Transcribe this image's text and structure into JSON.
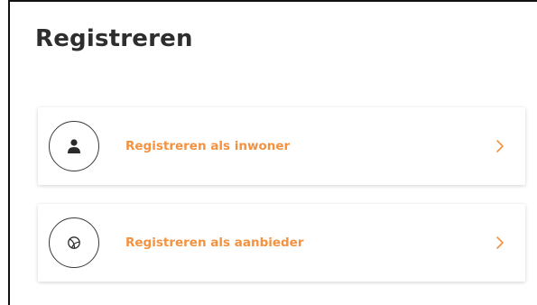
{
  "page": {
    "title": "Registreren"
  },
  "options": [
    {
      "label": "Registreren als inwoner",
      "icon": "person-icon"
    },
    {
      "label": "Registreren als aanbieder",
      "icon": "ball-icon"
    }
  ],
  "colors": {
    "accent": "#f39240",
    "title": "#2e2e2e",
    "icon": "#2b2b2b"
  }
}
